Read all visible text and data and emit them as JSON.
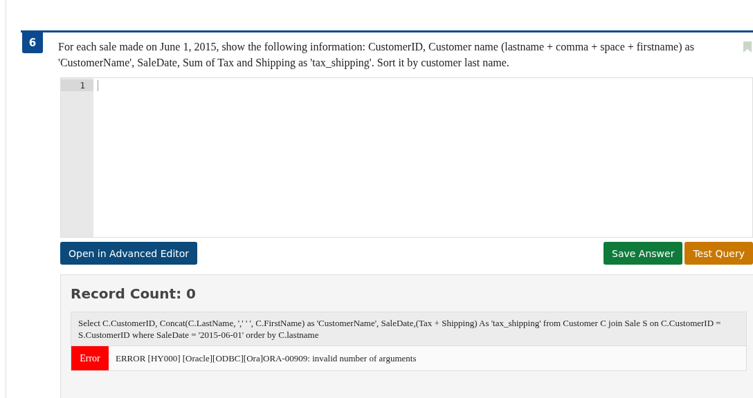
{
  "question": {
    "number": "6",
    "text": "For each sale made on June 1, 2015, show the following information:  CustomerID, Customer name (lastname + comma + space + firstname) as 'CustomerName', SaleDate, Sum of Tax and Shipping as 'tax_shipping'. Sort it by customer last name."
  },
  "editor": {
    "line_numbers": [
      "1"
    ]
  },
  "buttons": {
    "left": "Open in Advanced Editor",
    "save": "Save Answer",
    "test": "Test Query"
  },
  "result": {
    "record_count": "Record Count: 0",
    "query": "Select C.CustomerID, Concat(C.LastName, ',' ' ', C.FirstName) as 'CustomerName', SaleDate,(Tax + Shipping) As 'tax_shipping' from Customer C join Sale S on C.CustomerID = S.CustomerID where SaleDate = '2015-06-01' order by C.lastname",
    "status": "Error",
    "message": "ERROR [HY000] [Oracle][ODBC][Ora]ORA-00909: invalid number of arguments"
  }
}
